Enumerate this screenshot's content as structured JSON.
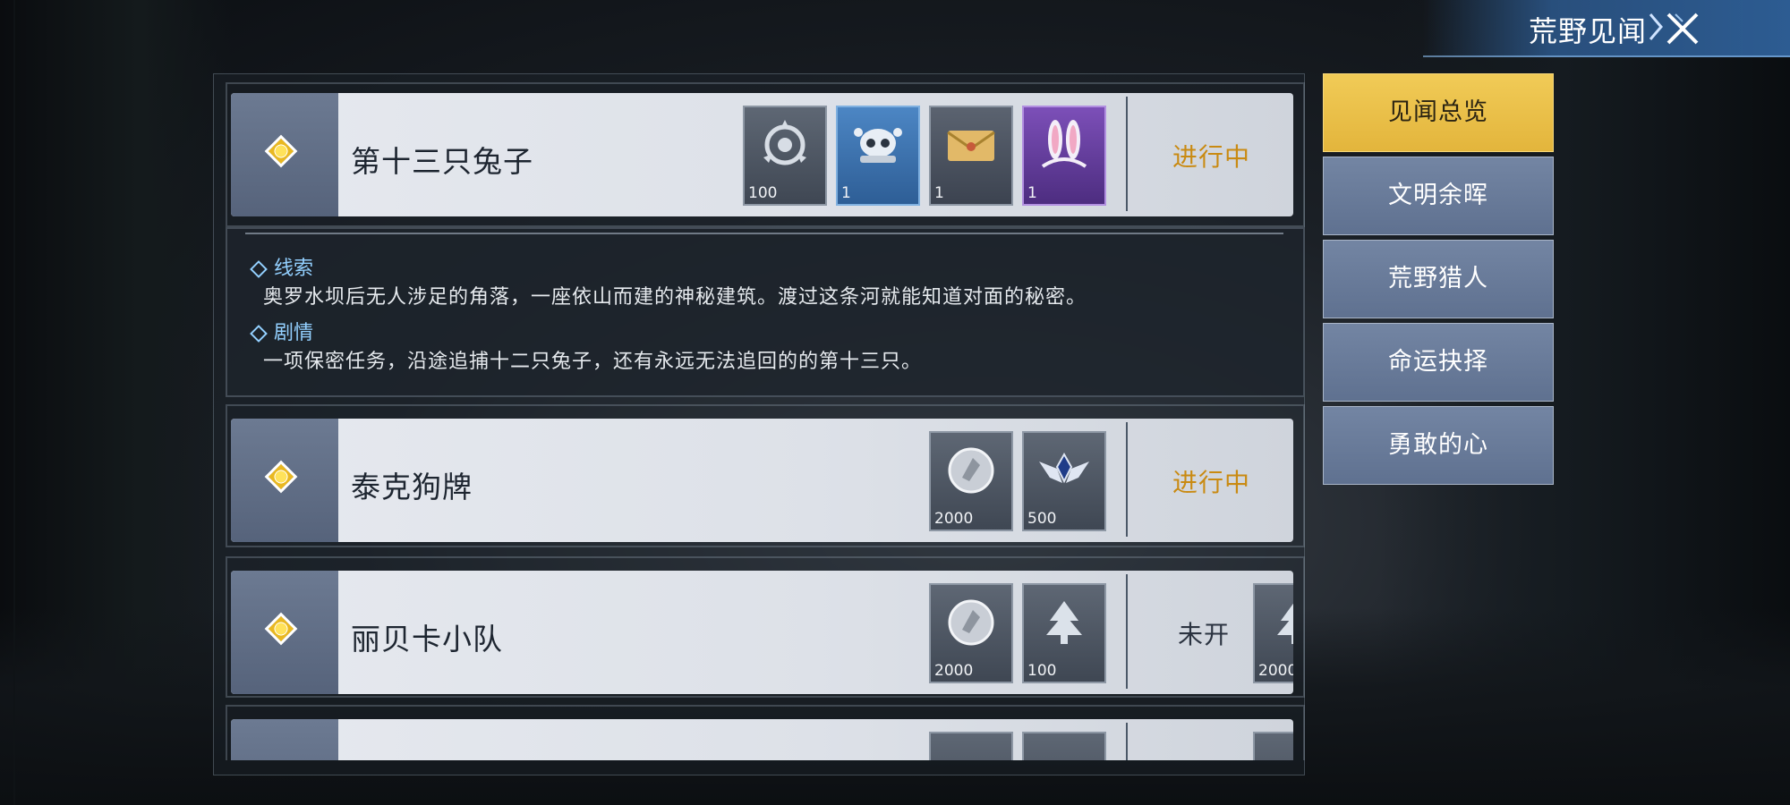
{
  "header": {
    "title": "荒野见闻"
  },
  "tabs": [
    {
      "label": "见闻总览",
      "active": true
    },
    {
      "label": "文明余晖",
      "active": false
    },
    {
      "label": "荒野猎人",
      "active": false
    },
    {
      "label": "命运抉择",
      "active": false
    },
    {
      "label": "勇敢的心",
      "active": false
    }
  ],
  "quests": [
    {
      "name": "第十三只兔子",
      "status": "进行中",
      "rewards": [
        {
          "icon": "badge-emblem-icon",
          "count": "100"
        },
        {
          "icon": "skull-cap-icon",
          "count": "1"
        },
        {
          "icon": "envelope-icon",
          "count": "1"
        },
        {
          "icon": "bunny-ears-icon",
          "count": "1"
        }
      ],
      "clue_label": "线索",
      "clue_text": "奥罗水坝后无人涉足的角落，一座依山而建的神秘建筑。渡过这条河就能知道对面的秘密。",
      "story_label": "剧情",
      "story_text": "一项保密任务，沿途追捕十二只兔子，还有永远无法追回的的第十三只。"
    },
    {
      "name": "泰克狗牌",
      "status": "进行中",
      "rewards": [
        {
          "icon": "silver-coin-icon",
          "count": "2000"
        },
        {
          "icon": "rank-wings-icon",
          "count": "500"
        }
      ]
    },
    {
      "name": "丽贝卡小队",
      "status": "未开",
      "rewards": [
        {
          "icon": "silver-coin-icon",
          "count": "2000"
        },
        {
          "icon": "tree-emblem-icon",
          "count": "100"
        }
      ],
      "popup_reward": {
        "icon": "tree-emblem-icon",
        "count": "2000"
      }
    }
  ],
  "colors": {
    "status_active": "#c98a12",
    "tab_active": "#e3b53c",
    "tab_idle": "#6a7c9a"
  }
}
